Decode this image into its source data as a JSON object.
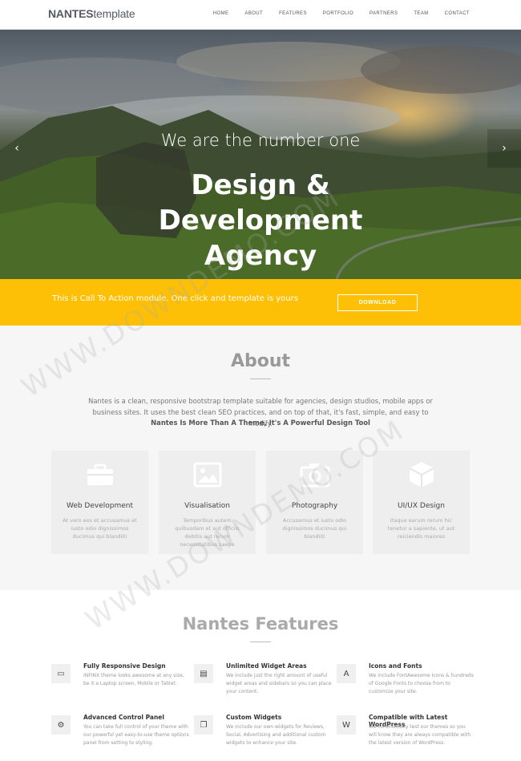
{
  "brand": {
    "bold": "NANTES",
    "light": "template"
  },
  "nav": [
    "HOME",
    "ABOUT",
    "FEATURES",
    "PORTFOLIO",
    "PARTNERS",
    "TEAM",
    "CONTACT"
  ],
  "hero": {
    "subtitle": "We are the number one",
    "title_line1": "Design &",
    "title_line2": "Development",
    "title_line3": "Agency",
    "arrow_left": "‹",
    "arrow_right": "›"
  },
  "cta": {
    "text": "This is Call To Action module. One click and template is yours",
    "button": "DOWNLOAD",
    "color": "#fdc006"
  },
  "about": {
    "title": "About",
    "text": "Nantes is a clean, responsive bootstrap template suitable for agencies, design studios, mobile apps or business sites. It uses the best clean SEO practices, and on top of that, it's fast, simple, and easy to modify.",
    "strong": "Nantes Is More Than A Theme, It's A Powerful Design Tool",
    "cards": [
      {
        "icon": "briefcase-icon",
        "title": "Web Development",
        "desc": "At vero eos et accusamus et iusto odio dignissimos ducimus qui blandiiti"
      },
      {
        "icon": "image-icon",
        "title": "Visualisation",
        "desc": "Temporibus autem quibusdam et aut officiis debitis aut rerum necessitatibus saepe"
      },
      {
        "icon": "camera-icon",
        "title": "Photography",
        "desc": "Accusamus et iusto odio dignissimos ducimus qui blandiiti"
      },
      {
        "icon": "cube-icon",
        "title": "UI/UX Design",
        "desc": "Itaque earum rerum hic tenetur a sapiente, ut aut reiciendis maiores"
      }
    ]
  },
  "features": {
    "title": "Nantes Features",
    "items": [
      {
        "icon": "monitor-icon",
        "glyph": "▭",
        "title": "Fully Responsive Design",
        "desc": "INFINX theme looks awesome at any size, be it a Laptop screen, Mobile or Tablet."
      },
      {
        "icon": "widget-icon",
        "glyph": "▤",
        "title": "Unlimited Widget Areas",
        "desc": "We include just the right amount of useful widget areas and sidebars so you can place your content."
      },
      {
        "icon": "font-icon",
        "glyph": "A",
        "title": "Icons and Fonts",
        "desc": "We include FontAwesome icons & hundreds of Google Fonts to choose from to customize your site."
      },
      {
        "icon": "cogs-icon",
        "glyph": "⚙",
        "title": "Advanced Control Panel",
        "desc": "You can take full control of your theme with our powerful yet easy-to-use theme options panel from setting to styling."
      },
      {
        "icon": "copy-icon",
        "glyph": "❐",
        "title": "Custom Widgets",
        "desc": "We include our own widgets for Reviews, Social, Advertising and additional custom widgets to enhance your site."
      },
      {
        "icon": "wordpress-icon",
        "glyph": "W",
        "title": "Compatible with Latest WordPress",
        "desc": "We continuously test our themes so you will know they are always compatible with the latest version of WordPress."
      }
    ]
  },
  "watermark": "WWW.DOWNDEMO.COM"
}
